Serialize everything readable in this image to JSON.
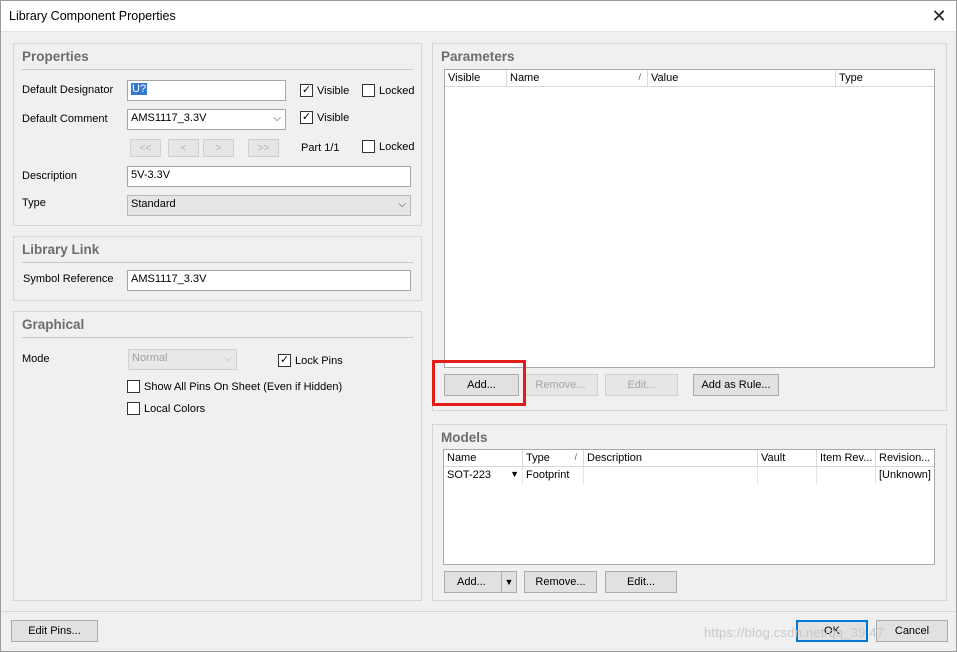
{
  "window": {
    "title": "Library Component Properties"
  },
  "properties": {
    "title": "Properties",
    "default_designator_label": "Default Designator",
    "default_designator_value": "U?",
    "visible_label": "Visible",
    "locked_label": "Locked",
    "default_comment_label": "Default Comment",
    "default_comment_value": "AMS1117_3.3V",
    "nav_first": "<<",
    "nav_prev": "<",
    "nav_next": ">",
    "nav_last": ">>",
    "part_label": "Part 1/1",
    "description_label": "Description",
    "description_value": "5V-3.3V",
    "type_label": "Type",
    "type_value": "Standard"
  },
  "library_link": {
    "title": "Library Link",
    "symbol_reference_label": "Symbol Reference",
    "symbol_reference_value": "AMS1117_3.3V"
  },
  "graphical": {
    "title": "Graphical",
    "mode_label": "Mode",
    "mode_value": "Normal",
    "lock_pins_label": "Lock Pins",
    "show_all_pins_label": "Show All Pins On Sheet (Even if Hidden)",
    "local_colors_label": "Local Colors"
  },
  "parameters": {
    "title": "Parameters",
    "columns": [
      "Visible",
      "Name",
      "Value",
      "Type"
    ],
    "sort_mark": "/",
    "add_button": "Add...",
    "remove_button": "Remove...",
    "edit_button": "Edit...",
    "add_as_rule_button": "Add as Rule..."
  },
  "models": {
    "title": "Models",
    "columns": [
      "Name",
      "Type",
      "Description",
      "Vault",
      "Item Rev...",
      "Revision..."
    ],
    "sort_mark": "/",
    "rows": [
      {
        "name": "SOT-223",
        "type": "Footprint",
        "description": "",
        "vault": "",
        "item_rev": "",
        "revision": "[Unknown]"
      }
    ],
    "add_button": "Add...",
    "remove_button": "Remove...",
    "edit_button": "Edit..."
  },
  "footer": {
    "edit_pins_button": "Edit Pins...",
    "ok_button": "OK",
    "cancel_button": "Cancel",
    "watermark": "https://blog.csdn.net/qq_39  47"
  },
  "colors": {
    "highlight": "#e11a1a",
    "selection": "#3478d2",
    "ok_border": "#0078d7"
  }
}
